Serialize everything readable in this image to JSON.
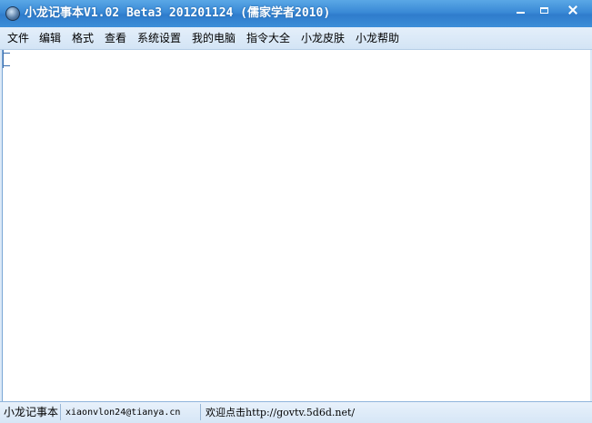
{
  "window": {
    "title": "小龙记事本V1.02 Beta3 201201124 (儒家学者2010)",
    "icon": "app-globe-icon",
    "controls": [
      "minimize-icon",
      "maximize-icon",
      "close-icon"
    ]
  },
  "menu": {
    "items": [
      "文件",
      "编辑",
      "格式",
      "查看",
      "系统设置",
      "我的电脑",
      "指令大全",
      "小龙皮肤",
      "小龙帮助"
    ]
  },
  "editor": {
    "content": ""
  },
  "status": {
    "app_name": "小龙记事本",
    "email": "xiaonvlon24@tianya.cn",
    "link_text": "欢迎点击http://govtv.5d6d.net/"
  },
  "colors": {
    "titlebar": "#3a8ad6",
    "menubar": "#d3e4f5",
    "statusbar": "#d6e6f6"
  }
}
